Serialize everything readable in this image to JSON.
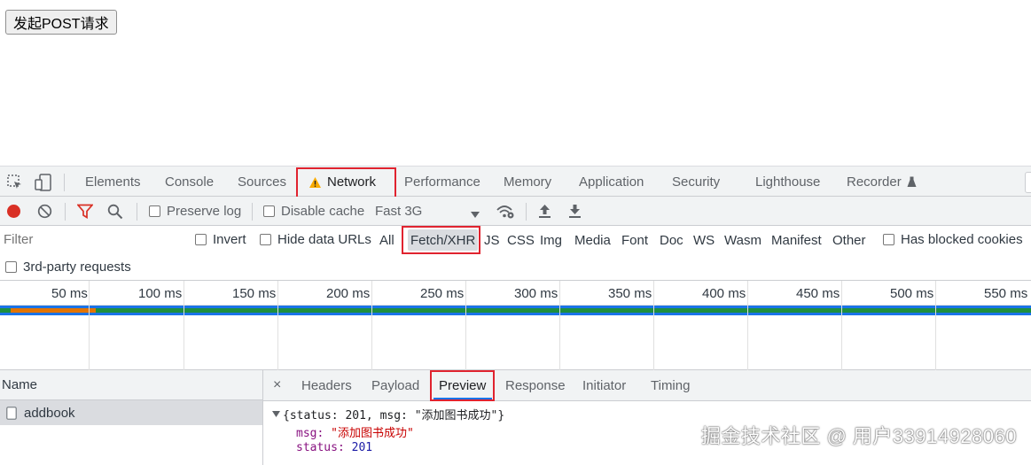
{
  "page": {
    "button_label": "发起POST请求"
  },
  "devtools": {
    "tabs": [
      "Elements",
      "Console",
      "Sources",
      "Network",
      "Performance",
      "Memory",
      "Application",
      "Security",
      "Lighthouse",
      "Recorder"
    ],
    "active_tab": "Network",
    "toolbar": {
      "preserve_log": "Preserve log",
      "disable_cache": "Disable cache",
      "throttle": "Fast 3G"
    },
    "filter": {
      "placeholder": "Filter",
      "invert": "Invert",
      "hide_data_urls": "Hide data URLs",
      "types": [
        "All",
        "Fetch/XHR",
        "JS",
        "CSS",
        "Img",
        "Media",
        "Font",
        "Doc",
        "WS",
        "Wasm",
        "Manifest",
        "Other"
      ],
      "active_type": "Fetch/XHR",
      "has_blocked_cookies": "Has blocked cookies",
      "third_party": "3rd-party requests"
    },
    "timeline": {
      "ticks": [
        "50 ms",
        "100 ms",
        "150 ms",
        "200 ms",
        "250 ms",
        "300 ms",
        "350 ms",
        "400 ms",
        "450 ms",
        "500 ms",
        "550 ms"
      ]
    },
    "requests": {
      "header": "Name",
      "items": [
        "addbook"
      ]
    },
    "detail": {
      "close": "×",
      "tabs": [
        "Headers",
        "Payload",
        "Preview",
        "Response",
        "Initiator",
        "Timing"
      ],
      "active_tab": "Preview",
      "preview": {
        "summary": "{status: 201, msg: \"添加图书成功\"}",
        "msg_key": "msg:",
        "msg_value": "\"添加图书成功\"",
        "status_key": "status:",
        "status_value": "201"
      }
    }
  },
  "watermark": "掘金技术社区 @ 用户33914928060",
  "colors": {
    "highlight": "#e0232f",
    "record": "#d93025",
    "bar_blue": "#1a73e8",
    "bar_green": "#1e8e3e",
    "bar_orange": "#e37400"
  }
}
